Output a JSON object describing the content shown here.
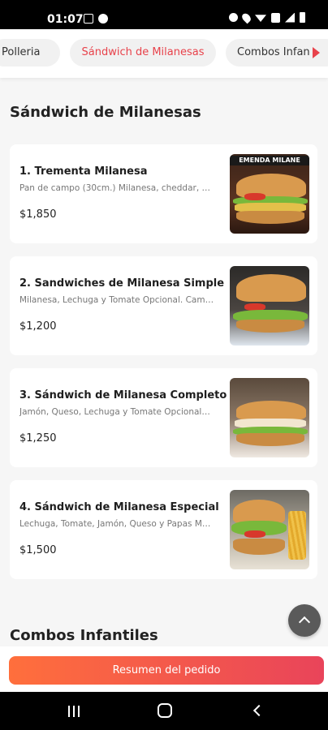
{
  "status_bar": {
    "time": "01:07"
  },
  "tabs": [
    {
      "label": "Polleria"
    },
    {
      "label": "Sándwich de Milanesas"
    },
    {
      "label": "Combos Infan"
    }
  ],
  "section_title": "Sándwich de Milanesas",
  "next_section_title": "Combos Infantiles",
  "products": [
    {
      "name": "1. Trementa Milanesa",
      "description": "Pan de campo (30cm.) Milanesa, cheddar, …",
      "price": "$1,850",
      "image_banner": "EMENDA MILANE"
    },
    {
      "name": "2. Sandwiches de Milanesa Simple",
      "description": "Milanesa, Lechuga y Tomate Opcional. Cam…",
      "price": "$1,200"
    },
    {
      "name": "3. Sándwich de Milanesa Completo",
      "description": "Jamón, Queso, Lechuga y Tomate Opcional…",
      "price": "$1,250"
    },
    {
      "name": "4. Sándwich de Milanesa Especial",
      "description": "Lechuga, Tomate, Jamón, Queso y Papas M…",
      "price": "$1,500"
    }
  ],
  "order_button_label": "Resumen del pedido",
  "colors": {
    "accent": "#e8424b",
    "gradient_start": "#ff6f3c",
    "gradient_end": "#e9445a"
  },
  "icons": {
    "scroll_top": "chevron-up-icon",
    "tab_scroll": "triangle-right-icon",
    "nav_recent": "recent-apps-icon",
    "nav_home": "home-icon",
    "nav_back": "back-icon"
  }
}
